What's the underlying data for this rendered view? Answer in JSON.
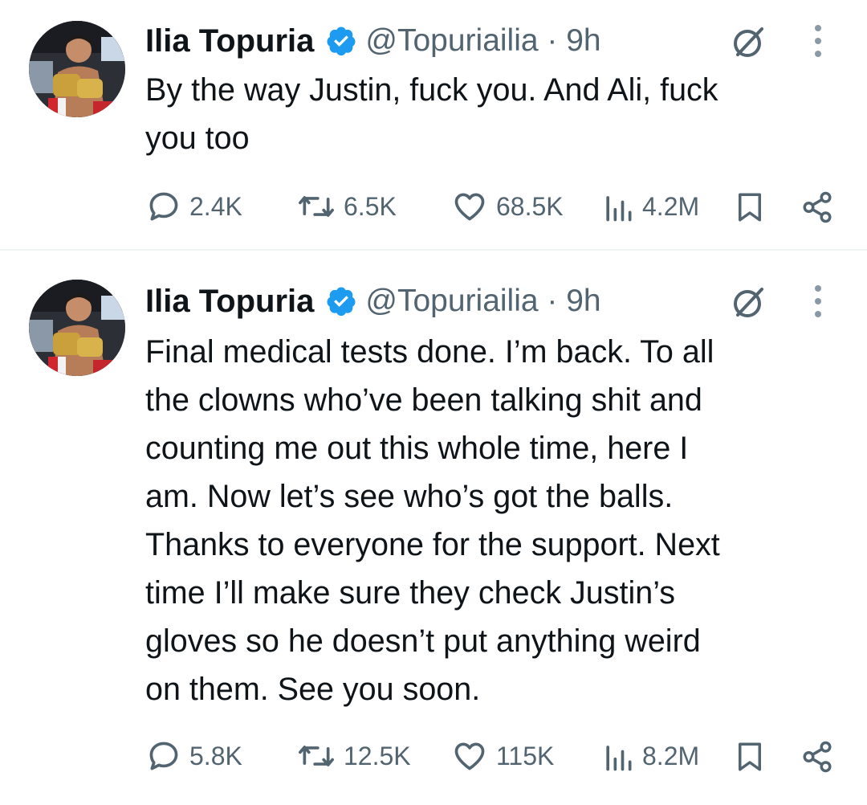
{
  "colors": {
    "text": "#0f1419",
    "secondary": "#536471",
    "verified_badge": "#1d9bf0",
    "divider": "#eff3f4"
  },
  "tweets": [
    {
      "name": "Ilia Topuria",
      "handle": "@Topuriailia · 9h",
      "text": "By the way Justin, fuck you. And Ali, fuck\nyou too",
      "replies": "2.4K",
      "retweets": "6.5K",
      "likes": "68.5K",
      "views": "4.2M"
    },
    {
      "name": "Ilia Topuria",
      "handle": "@Topuriailia · 9h",
      "text": "Final medical tests done. I’m back. To all\nthe clowns who’ve been talking shit and\ncounting me out this whole time, here I\nam. Now let’s see who’s got the balls.\nThanks to everyone for the support. Next\ntime I’ll make sure they check Justin’s\ngloves so he doesn’t put anything weird\non them. See you soon.",
      "replies": "5.8K",
      "retweets": "12.5K",
      "likes": "115K",
      "views": "8.2M"
    }
  ],
  "icons": {
    "avatar": "profile-photo",
    "verified": "verified-badge-icon",
    "grok": "grok-icon",
    "more": "more-icon",
    "reply": "reply-icon",
    "retweet": "retweet-icon",
    "like": "heart-icon",
    "views": "views-chart-icon",
    "bookmark": "bookmark-icon",
    "share": "share-icon"
  }
}
